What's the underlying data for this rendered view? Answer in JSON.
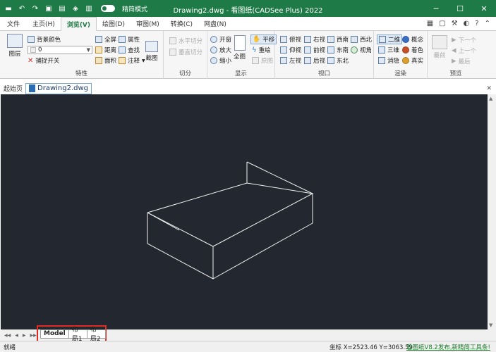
{
  "window": {
    "title": "Drawing2.dwg - 看图纸(CADSee Plus) 2022",
    "mode_label": "精简模式"
  },
  "ribbon_tabs": [
    {
      "label": "文件"
    },
    {
      "label": "主页(H)"
    },
    {
      "label": "浏览(V)",
      "active": true
    },
    {
      "label": "绘图(D)"
    },
    {
      "label": "审图(M)"
    },
    {
      "label": "转换(C)"
    },
    {
      "label": "网盘(N)"
    }
  ],
  "groups": {
    "properties": {
      "label": "特性",
      "layers": "图层",
      "bg_color": "背景颜色",
      "layer_value": "0",
      "snap": "捕捉开关",
      "fullscreen": "全屏",
      "distance": "距离",
      "area": "面积",
      "attributes": "属性",
      "find": "查找",
      "annotate": "注释",
      "screenshot": "截图"
    },
    "cut": {
      "label": "切分",
      "horizontal": "水平切分",
      "vertical": "垂直切分"
    },
    "display": {
      "label": "显示",
      "window": "开窗",
      "zoom_in": "放大",
      "zoom_out": "缩小",
      "full_view": "全图",
      "pan": "平移",
      "regen": "重绘",
      "original": "原图"
    },
    "viewport": {
      "label": "视口",
      "top": "俯视",
      "bottom": "仰视",
      "left": "左视",
      "right": "右视",
      "front": "前视",
      "back": "后视",
      "sw": "西南",
      "se": "东南",
      "ne": "东北",
      "nw": "西北",
      "view": "视角"
    },
    "render": {
      "label": "渲染",
      "two_d": "二维",
      "three_d": "三维",
      "hidden": "消隐",
      "concept": "概念",
      "shaded": "着色",
      "realistic": "真实"
    },
    "preview": {
      "label": "预览",
      "preview": "最前",
      "next": "下一个",
      "prev": "上一个",
      "last": "最后"
    }
  },
  "documents": {
    "home": "起始页",
    "active": "Drawing2.dwg"
  },
  "layouts": [
    {
      "label": "Model",
      "active": true
    },
    {
      "label": "布局1"
    },
    {
      "label": "布局2"
    }
  ],
  "status": {
    "ready": "就绪",
    "coordinates": "坐标 X=2523.46 Y=3063.59",
    "news": "看图纸V8.2发布,新精简工具条!"
  },
  "colors": {
    "titlebar": "#1e7a46",
    "canvas": "#232830",
    "highlight": "#e02b20"
  }
}
